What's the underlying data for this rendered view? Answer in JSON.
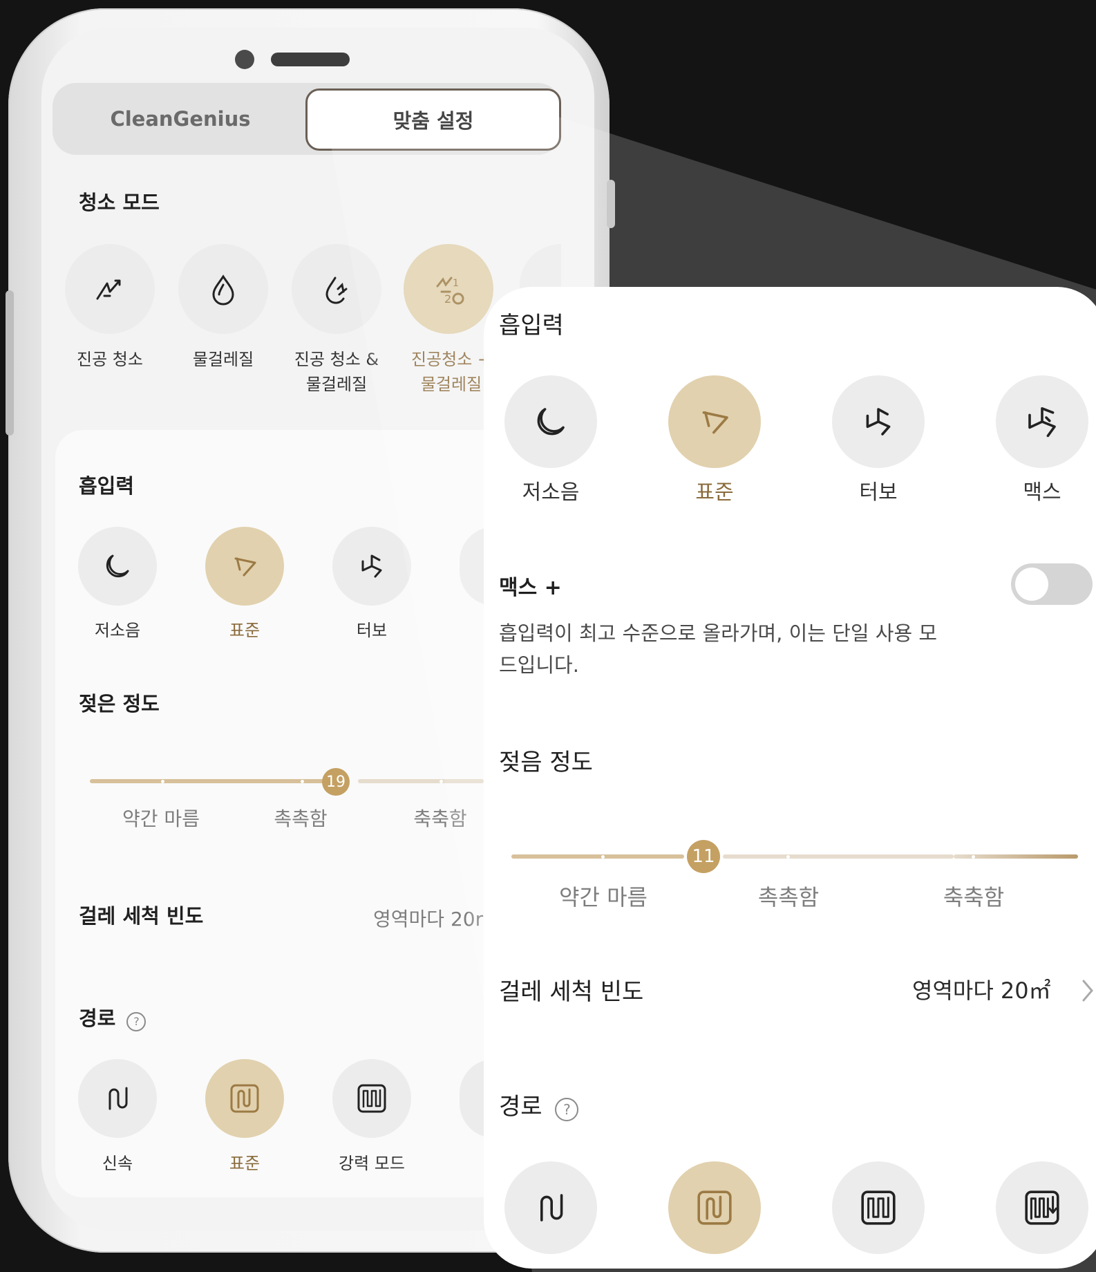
{
  "tabs": {
    "clean_genius": "CleanGenius",
    "custom": "맞춤 설정"
  },
  "clean_mode": {
    "title": "청소 모드",
    "items": [
      {
        "label": "진공 청소",
        "icon": "vacuum-icon"
      },
      {
        "label": "물걸레질",
        "icon": "water-drop-icon"
      },
      {
        "label": "진공 청소 &\n물걸레질",
        "icon": "vacuum-mop-icon"
      },
      {
        "label": "진공청소 +\n물걸레질",
        "icon": "vacuum-then-mop-icon",
        "selected": true
      }
    ]
  },
  "suction": {
    "title": "흡입력",
    "items": [
      {
        "label": "저소음",
        "icon": "moon-icon"
      },
      {
        "label": "표준",
        "icon": "fan-standard-icon",
        "selected": true
      },
      {
        "label": "터보",
        "icon": "fan-turbo-icon"
      },
      {
        "label": "맥스",
        "icon": "fan-max-icon"
      }
    ],
    "max_plus": {
      "label": "맥스 +",
      "enabled": false
    },
    "description": "흡입력이 최고 수준으로 올라가며, 이는 단일 사용 모\n드입니다."
  },
  "phone_wetness": {
    "title": "젖은 정도",
    "value": "19",
    "labels": [
      "약간 마름",
      "촉촉함",
      "축축함"
    ]
  },
  "wetness": {
    "title": "젖음 정도",
    "value": "11",
    "labels": [
      "약간 마름",
      "촉촉함",
      "축축함"
    ]
  },
  "mop_wash": {
    "title": "걸레 세척 빈도",
    "value": "영역마다 20㎡",
    "value_cut": "영역마다 20r"
  },
  "route": {
    "title": "경로",
    "help": "?",
    "items": [
      {
        "label": "신속",
        "icon": "route-quick-icon"
      },
      {
        "label": "표준",
        "icon": "route-standard-icon",
        "selected": true
      },
      {
        "label": "강력 모드",
        "icon": "route-intensive-icon"
      },
      {
        "label": "",
        "icon": "route-deep-icon"
      }
    ]
  },
  "colors": {
    "accent": "#c4a062",
    "selected_bg": "#e1d1ae",
    "selected_text": "#8a6b3b",
    "background": "#141414"
  }
}
